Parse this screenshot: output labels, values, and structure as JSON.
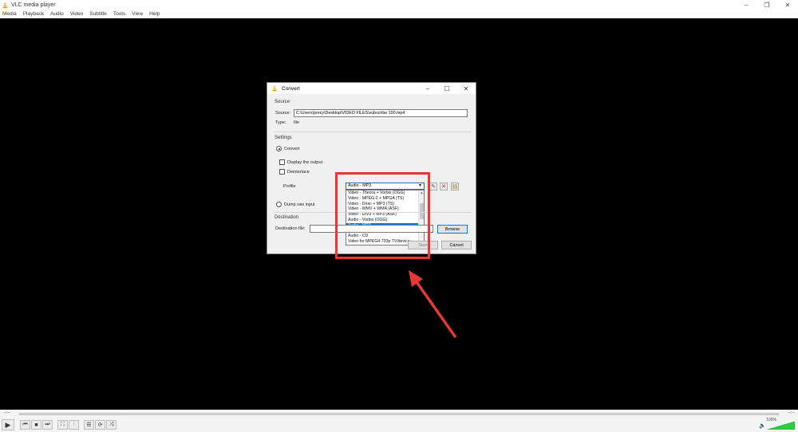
{
  "window": {
    "title": "VLC media player",
    "controls": [
      "–",
      "❐",
      "✕"
    ]
  },
  "menu": [
    "Media",
    "Playback",
    "Audio",
    "Video",
    "Subtitle",
    "Tools",
    "View",
    "Help"
  ],
  "dialog": {
    "title": "Convert",
    "controls": [
      "–",
      "☐",
      "✕"
    ],
    "source_section": "Source",
    "source_label": "Source:",
    "source_value": "C:\\Users\\precy\\Desktop\\VIDEO FILES\\subscribe 100.mp4",
    "type_label": "Type:",
    "type_value": "file",
    "settings_section": "Settings",
    "convert_label": "Convert",
    "display_output_label": "Display the output",
    "deinterlace_label": "Deinterlace",
    "profile_label": "Profile",
    "profile_selected": "Audio - MP3",
    "profile_options": [
      "Video - Theora + Vorbis (OGG)",
      "Video - MPEG-2 + MPGA (TS)",
      "Video - Dirac + MP3 (TS)",
      "Video - WMV + WMA (ASF)",
      "Video - DIV3 + MP3 (ASF)",
      "Audio - Vorbis (OGG)",
      "Audio - MP3",
      "Audio - FLAC",
      "Audio - CD",
      "Video for MPEG4 720p TV/device"
    ],
    "highlighted_option": "Audio - MP3",
    "dump_raw_label": "Dump raw input",
    "destination_section": "Destination",
    "destination_label": "Destination file:",
    "browse_label": "Browse",
    "start_label": "Start",
    "cancel_label": "Cancel"
  },
  "player": {
    "time_elapsed": "--:--",
    "time_total": "--:--",
    "volume": "100%",
    "colors": {
      "accent": "#e53935",
      "volume": "#2ecc40"
    }
  }
}
